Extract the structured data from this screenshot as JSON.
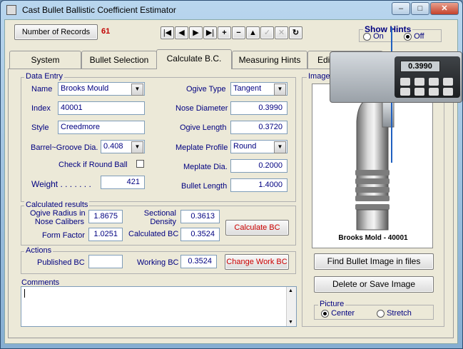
{
  "window": {
    "title": "Cast Bullet Ballistic Coefficient Estimator"
  },
  "titlebar": {
    "minimize": "–",
    "maximize": "□",
    "close": "✕"
  },
  "records": {
    "button_label": "Number of Records",
    "count": "61"
  },
  "nav": {
    "first": "|◀",
    "prev": "◀",
    "next": "▶",
    "last": "▶|",
    "add": "+",
    "delete": "−",
    "up": "▲",
    "edit": "✓",
    "cancel": "✕",
    "refresh": "↻"
  },
  "hints": {
    "title": "Show Hints",
    "on_label": "On",
    "off_label": "Off",
    "selected": "Off"
  },
  "tabs": [
    {
      "label": "System"
    },
    {
      "label": "Bullet Selection"
    },
    {
      "label": "Calculate B.C."
    },
    {
      "label": "Measuring Hints"
    },
    {
      "label": "Edit Name List"
    }
  ],
  "data_entry": {
    "legend": "Data Entry",
    "name_label": "Name",
    "name_value": "Brooks Mould",
    "index_label": "Index",
    "index_value": "40001",
    "style_label": "Style",
    "style_value": "Creedmore",
    "barrel_label": "Barrel~Groove Dia.",
    "barrel_value": "0.408",
    "roundball_label": "Check if Round Ball",
    "weight_label": "Weight . . . . . . .",
    "weight_value": "421",
    "ogive_type_label": "Ogive Type",
    "ogive_type_value": "Tangent",
    "nose_dia_label": "Nose Diameter",
    "nose_dia_value": "0.3990",
    "ogive_len_label": "Ogive Length",
    "ogive_len_value": "0.3720",
    "meplate_profile_label": "Meplate Profile",
    "meplate_profile_value": "Round",
    "meplate_dia_label": "Meplate Dia.",
    "meplate_dia_value": "0.2000",
    "bullet_len_label": "Bullet Length",
    "bullet_len_value": "1.4000"
  },
  "calc": {
    "legend": "Calculated results",
    "ogive_radius_label_1": "Ogive Radius in",
    "ogive_radius_label_2": "Nose Calibers",
    "ogive_radius_value": "1.8675",
    "form_factor_label": "Form Factor",
    "form_factor_value": "1.0251",
    "sectional_label_1": "Sectional",
    "sectional_label_2": "Density",
    "sectional_value": "0.3613",
    "calc_bc_label": "Calculated BC",
    "calc_bc_value": "0.3524",
    "calc_button": "Calculate BC"
  },
  "actions": {
    "legend": "Actions",
    "published_label": "Published BC",
    "published_value": "",
    "working_label": "Working BC",
    "working_value": "0.3524",
    "change_button": "Change Work BC"
  },
  "comments": {
    "legend": "Comments",
    "value": ""
  },
  "image": {
    "legend": "Image",
    "caption": "Brooks Mold - 40001",
    "caliper_readout": "0.3990",
    "find_button": "Find Bullet Image in files",
    "delete_button": "Delete or Save Image"
  },
  "picture": {
    "legend": "Picture",
    "center_label": "Center",
    "stretch_label": "Stretch",
    "selected": "Center"
  }
}
